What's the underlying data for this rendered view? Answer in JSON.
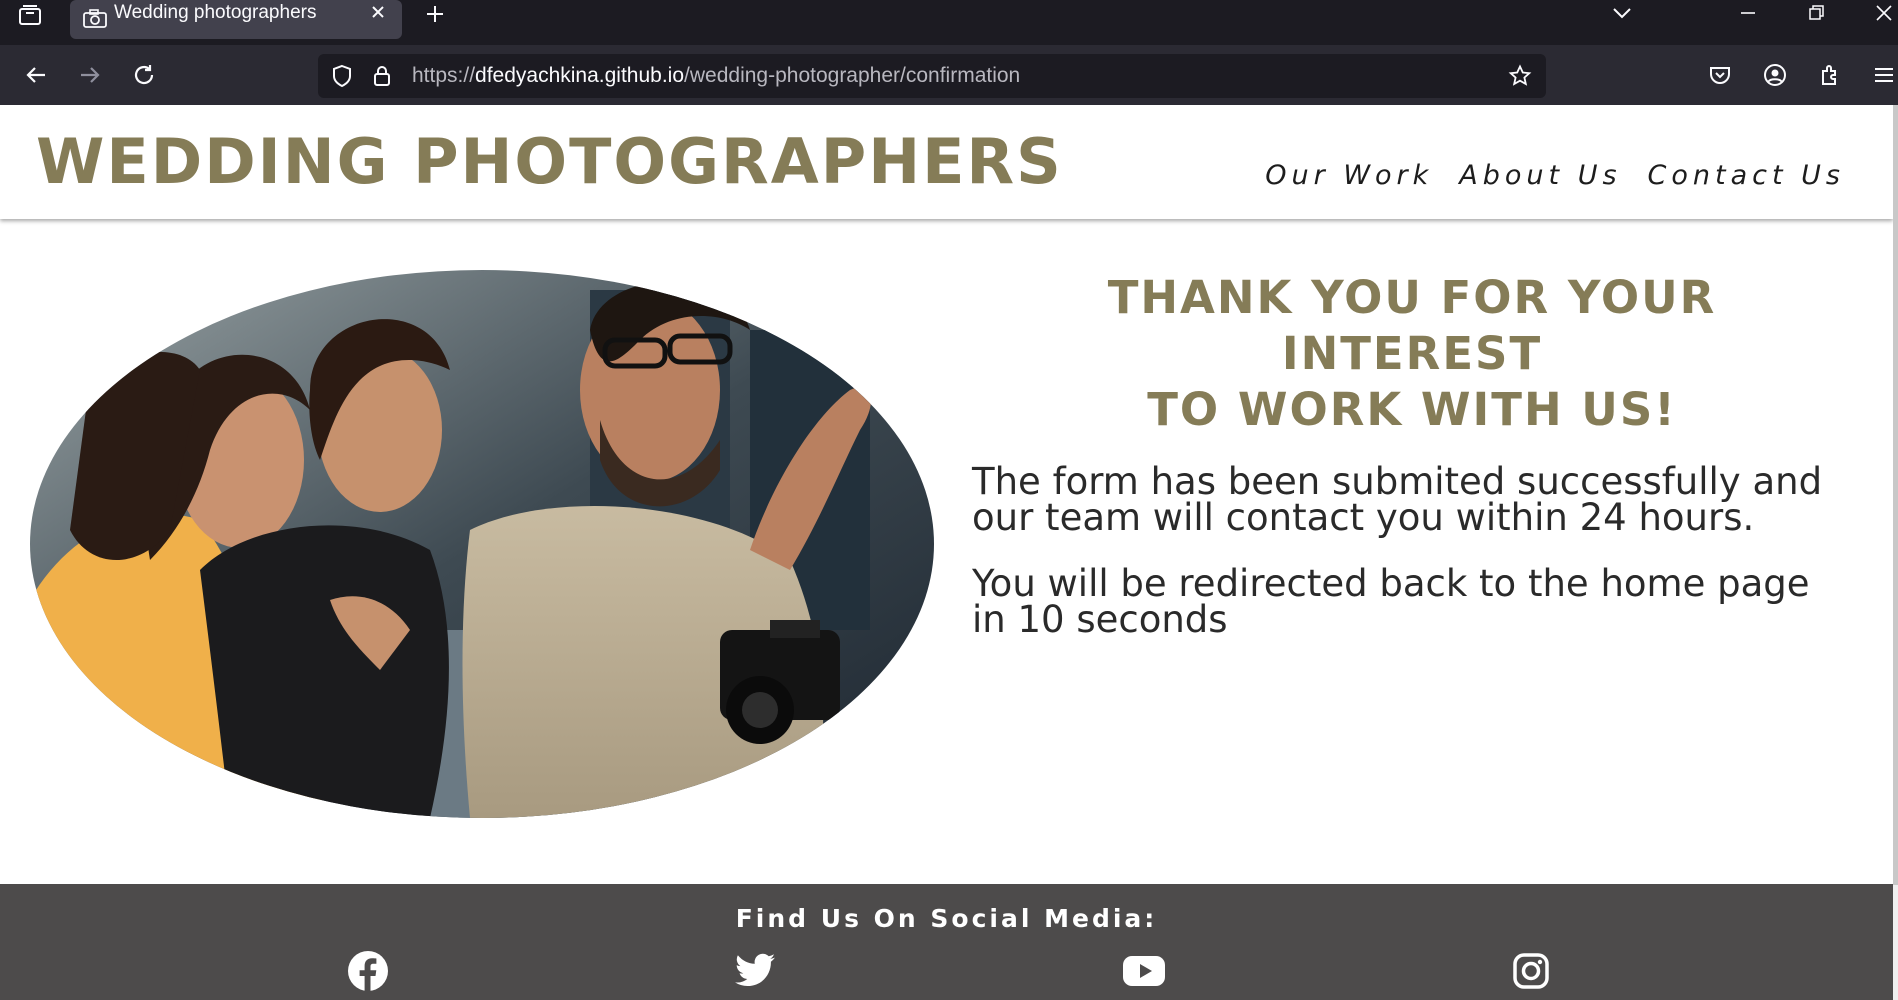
{
  "browser": {
    "tab_title": "Wedding photographers",
    "url_scheme": "https://",
    "url_host": "dfedyachkina.github.io",
    "url_path": "/wedding-photographer/confirmation"
  },
  "site": {
    "logo": "WEDDING PHOTOGRAPHERS",
    "nav": [
      "Our Work",
      "About Us",
      "Contact Us"
    ]
  },
  "main": {
    "heading_line1": "THANK YOU FOR YOUR INTEREST",
    "heading_line2": "TO WORK WITH US!",
    "message1": "The form has been submited successfully and our team will contact you within 24 hours.",
    "message2": "You will be redirected back to the home page in 10 seconds"
  },
  "footer": {
    "title": "Find Us On Social Media:",
    "icons": [
      "facebook-icon",
      "twitter-icon",
      "youtube-icon",
      "instagram-icon"
    ]
  },
  "colors": {
    "brand": "#857c57",
    "footer_bg": "#4d4b4b",
    "chrome_bg": "#1c1b22"
  }
}
